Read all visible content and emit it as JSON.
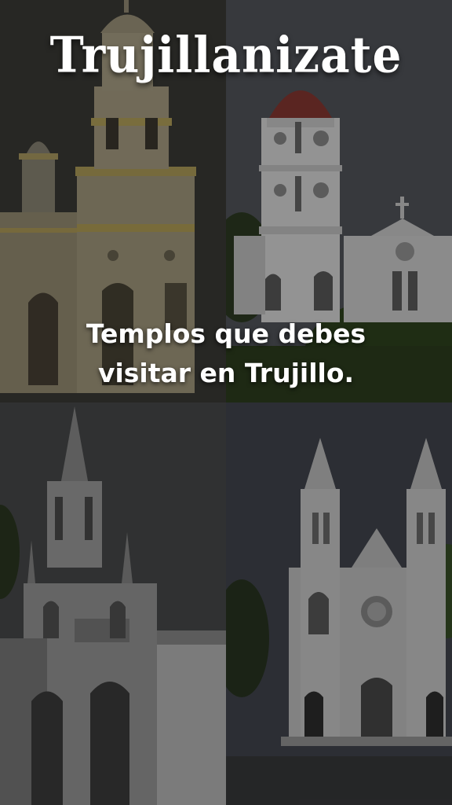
{
  "brand": {
    "title": "Trujillanizate"
  },
  "headline": {
    "line1": "Templos que debes",
    "line2": "visitar en Trujillo."
  },
  "colors": {
    "text": "#ffffff",
    "overlay": "rgba(0,0,0,0.35)"
  }
}
